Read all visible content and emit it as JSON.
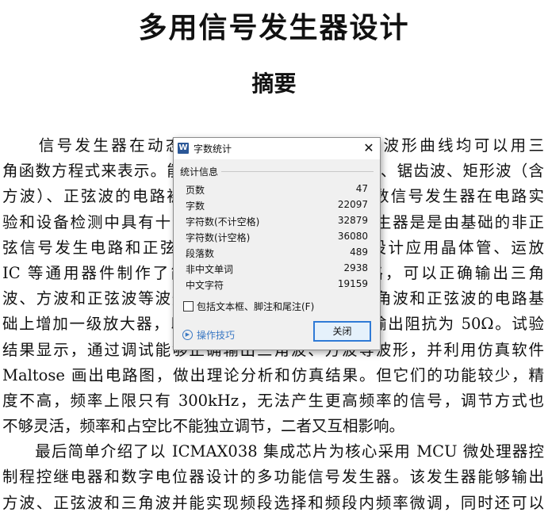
{
  "document": {
    "title": "多用信号发生器设计",
    "abstract_heading": "摘要",
    "lines": [
      "　　信号发生器在动态测试中有重要作用，各种波形曲线均可以用三",
      "角函数方程式来表示。能够产生多种波形，如三角波、锯齿波、矩形波（含",
      "方波）、正弦波的电路被称为函数信号发生器。函数信号发生器在电路实",
      "验和设备检测中具有十分广泛的用途。函数信号发生器是是由基础的非正",
      "弦信号发生电路和正弦信号发生电路组成。本文设计应用晶体管、运放",
      "IC 等通用器件制作了简单的函数信号发生器电路，可以正确输出三角",
      "波、方波和正弦波等波形。在此基础上，在产生三角波和正弦波的电路基",
      "础上增加一级放大器，以提高输出电压幅度，降低输出阻抗为 50Ω。试验",
      "结果显示，通过调试能够正确输出三角波、方波等波形，并利用仿真软件",
      "Maltose 画出电路图，做出理论分析和仿真结果。但它们的功能较少，精",
      "度不高，频率上限只有 300kHz，无法产生更高频率的信号，调节方式也",
      "不够灵活，频率和占空比不能独立调节，二者又互相影响。",
      "　　最后简单介绍了以 ICMAX038 集成芯片为核心采用 MCU 微处理器控",
      "制程控继电器和数字电位器设计的多功能信号发生器。该发生器能够输出",
      "方波、正弦波和三角波并能实现频段选择和频段内频率微调，同时还可以"
    ]
  },
  "dialog": {
    "app_icon": "W",
    "title": "字数统计",
    "close_glyph": "✕",
    "group_label": "统计信息",
    "stats": [
      {
        "label": "页数",
        "value": "47"
      },
      {
        "label": "字数",
        "value": "22097"
      },
      {
        "label": "字符数(不计空格)",
        "value": "32879"
      },
      {
        "label": "字符数(计空格)",
        "value": "36080"
      },
      {
        "label": "段落数",
        "value": "489"
      },
      {
        "label": "非中文单词",
        "value": "2938"
      },
      {
        "label": "中文字符",
        "value": "19159"
      }
    ],
    "checkbox_label": "包括文本框、脚注和尾注(F)",
    "checkbox_checked": false,
    "tips_label": "操作技巧",
    "close_button_label": "关闭",
    "accent_color": "#2f7ad6",
    "link_color": "#3a78c3"
  }
}
